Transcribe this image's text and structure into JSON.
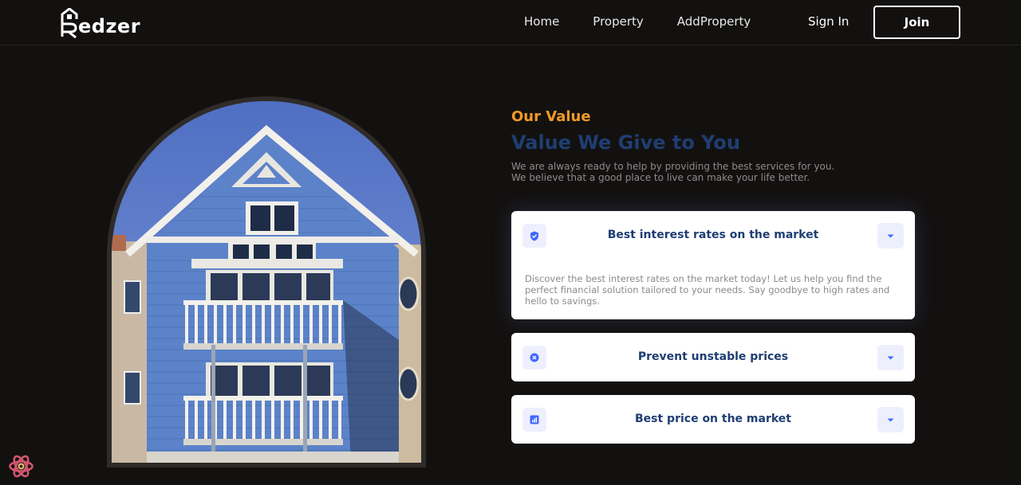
{
  "nav": {
    "logo_text": "edzer",
    "links": [
      "Home",
      "Property",
      "AddProperty"
    ],
    "signin_label": "Sign In",
    "join_label": "Join"
  },
  "value_section": {
    "eyebrow": "Our Value",
    "title": "Value We Give to You",
    "description_line1": "We are always ready to help by providing the best services for you.",
    "description_line2": "We believe that a good place to live can make your life better."
  },
  "accordion": [
    {
      "icon": "shield-check-icon",
      "title": "Best interest rates on the market",
      "expanded": true,
      "body": "Discover the best interest rates on the market today! Let us help you find the perfect financial solution tailored to your needs. Say goodbye to high rates and hello to savings."
    },
    {
      "icon": "close-circle-icon",
      "title": "Prevent unstable prices",
      "expanded": false
    },
    {
      "icon": "bar-chart-icon",
      "title": "Best price on the market",
      "expanded": false
    }
  ],
  "colors": {
    "background": "#131110",
    "accent_orange": "#f29a26",
    "primary_blue": "#1f3e72",
    "icon_bg": "#eeeffd",
    "icon_blue": "#4066ff"
  },
  "image": {
    "subject": "blue-house-photo-icon"
  }
}
